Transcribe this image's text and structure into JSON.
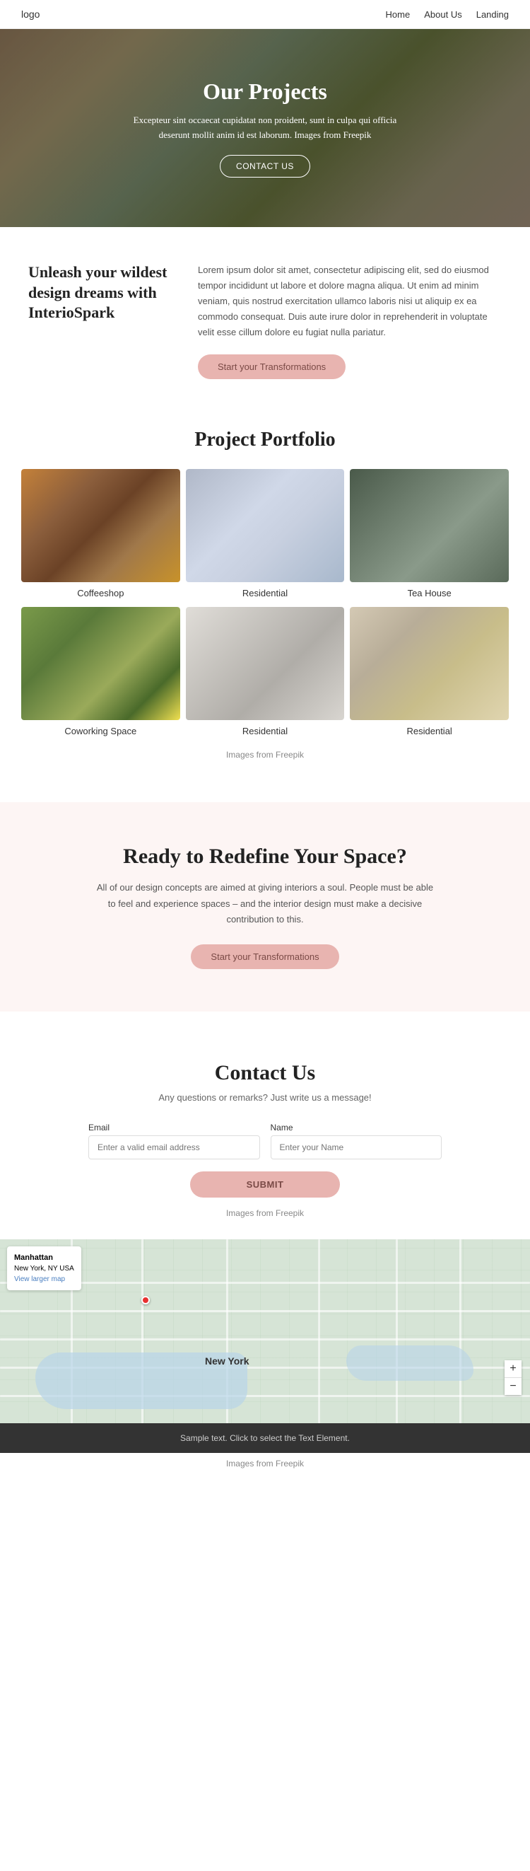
{
  "navbar": {
    "logo": "logo",
    "links": [
      {
        "label": "Home",
        "href": "#"
      },
      {
        "label": "About Us",
        "href": "#"
      },
      {
        "label": "Landing",
        "href": "#"
      }
    ]
  },
  "hero": {
    "title": "Our Projects",
    "description": "Excepteur sint occaecat cupidatat non proident, sunt in culpa qui officia deserunt mollit anim id est laborum. Images from",
    "freepik_link": "Freepik",
    "cta_label": "CONTACT US"
  },
  "about": {
    "heading": "Unleash your wildest design dreams with InterioSpark",
    "body": "Lorem ipsum dolor sit amet, consectetur adipiscing elit, sed do eiusmod tempor incididunt ut labore et dolore magna aliqua. Ut enim ad minim veniam, quis nostrud exercitation ullamco laboris nisi ut aliquip ex ea commodo consequat. Duis aute irure dolor in reprehenderit in voluptate velit esse cillum dolore eu fugiat nulla pariatur.",
    "cta_label": "Start your Transformations"
  },
  "portfolio": {
    "title": "Project Portfolio",
    "items": [
      {
        "label": "Coffeeshop",
        "img_class": "img-coffeeshop"
      },
      {
        "label": "Residential",
        "img_class": "img-residential1"
      },
      {
        "label": "Tea House",
        "img_class": "img-teahouse"
      },
      {
        "label": "Coworking Space",
        "img_class": "img-coworking"
      },
      {
        "label": "Residential",
        "img_class": "img-residential2"
      },
      {
        "label": "Residential",
        "img_class": "img-residential3"
      }
    ],
    "note": "Images from",
    "freepik_link": "Freepik"
  },
  "redefine": {
    "title": "Ready to Redefine Your Space?",
    "description": "All of our design concepts are aimed at giving interiors a soul. People must be able to feel and experience spaces – and the interior design must make a decisive contribution to this.",
    "cta_label": "Start your Transformations"
  },
  "contact": {
    "title": "Contact Us",
    "subtitle": "Any questions or remarks? Just write us a message!",
    "email_placeholder": "Enter a valid email address",
    "name_placeholder": "Enter your Name",
    "email_label": "Email",
    "name_label": "Name",
    "submit_label": "SUBMIT",
    "note": "Images from",
    "freepik_link": "Freepik"
  },
  "map": {
    "location": "Manhattan",
    "address": "New York, NY USA",
    "link_label": "View larger map",
    "city_label": "New York",
    "zoom_in": "+",
    "zoom_out": "−"
  },
  "footer": {
    "sample_text": "Sample text. Click to select the Text Element.",
    "note": "Images from",
    "freepik_link": "Freepik"
  }
}
